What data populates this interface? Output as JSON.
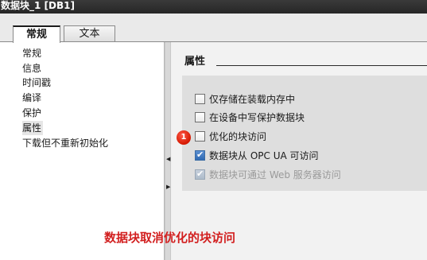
{
  "window": {
    "title": "数据块_1 [DB1]"
  },
  "tabs": [
    {
      "label": "常规",
      "active": true
    },
    {
      "label": "文本",
      "active": false
    }
  ],
  "nav": {
    "items": [
      {
        "label": "常规",
        "selected": false
      },
      {
        "label": "信息",
        "selected": false
      },
      {
        "label": "时间戳",
        "selected": false
      },
      {
        "label": "编译",
        "selected": false
      },
      {
        "label": "保护",
        "selected": false
      },
      {
        "label": "属性",
        "selected": true
      },
      {
        "label": "下载但不重新初始化",
        "selected": false
      }
    ]
  },
  "section": {
    "title": "属性"
  },
  "options": [
    {
      "label": "仅存储在装载内存中",
      "checked": false,
      "enabled": true
    },
    {
      "label": "在设备中写保护数据块",
      "checked": false,
      "enabled": true
    },
    {
      "label": "优化的块访问",
      "checked": false,
      "enabled": true
    },
    {
      "label": "数据块从 OPC UA 可访问",
      "checked": true,
      "enabled": true
    },
    {
      "label": "数据块可通过 Web 服务器访问",
      "checked": true,
      "enabled": false
    }
  ],
  "annotation": {
    "badge": "1",
    "caption": "数据块取消优化的块访问"
  },
  "colors": {
    "accent_red": "#d21f1f",
    "checkbox_blue": "#2f69b3",
    "titlebar": "#2b2b2b"
  }
}
